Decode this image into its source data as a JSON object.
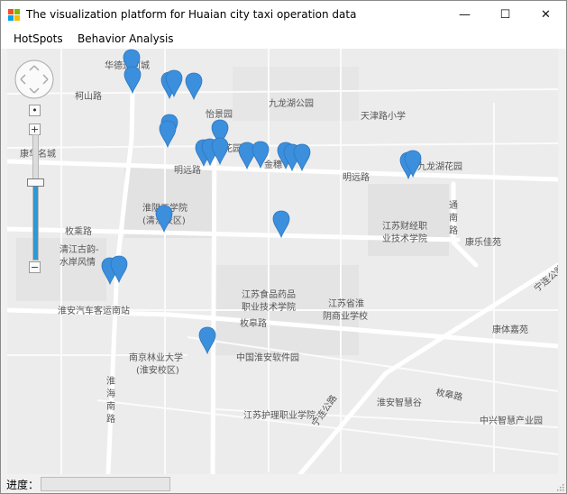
{
  "window": {
    "title": "The visualization platform for Huaian city taxi operation data",
    "minimize_label": "—",
    "maximize_label": "☐",
    "close_label": "✕"
  },
  "menu": {
    "items": [
      {
        "label": "HotSpots"
      },
      {
        "label": "Behavior Analysis"
      }
    ]
  },
  "map": {
    "zoom_in_label": "+",
    "zoom_out_label": "−",
    "zoom_out_min_label": "−",
    "center_label": "•",
    "zoom_level": 0.62,
    "marker_color": "#3b8fdd",
    "place_labels": [
      {
        "text": "华德运河城"
      },
      {
        "text": "柯山路"
      },
      {
        "text": "九龙湖公园"
      },
      {
        "text": "天津路小学"
      },
      {
        "text": "怡景园"
      },
      {
        "text": "康华名城"
      },
      {
        "text": "花园"
      },
      {
        "text": "明远路"
      },
      {
        "text": "金穗"
      },
      {
        "text": "明远路"
      },
      {
        "text": "九龙湖花园"
      },
      {
        "text": "淮阴工学院"
      },
      {
        "text": "(清江校区)"
      },
      {
        "text": "通"
      },
      {
        "text": "南"
      },
      {
        "text": "路"
      },
      {
        "text": "江苏财经职"
      },
      {
        "text": "业技术学院"
      },
      {
        "text": "康乐佳苑"
      },
      {
        "text": "枚乘路"
      },
      {
        "text": "清江古韵-"
      },
      {
        "text": "水岸风情"
      },
      {
        "text": "宁连公路"
      },
      {
        "text": "江苏食品药品"
      },
      {
        "text": "职业技术学院"
      },
      {
        "text": "江苏省淮"
      },
      {
        "text": "阴商业学校"
      },
      {
        "text": "淮安汽车客运南站"
      },
      {
        "text": "枚皋路"
      },
      {
        "text": "康体嘉苑"
      },
      {
        "text": "南京林业大学"
      },
      {
        "text": "(淮安校区)"
      },
      {
        "text": "中国淮安软件园"
      },
      {
        "text": "淮"
      },
      {
        "text": "海"
      },
      {
        "text": "南"
      },
      {
        "text": "路"
      },
      {
        "text": "枚皋路"
      },
      {
        "text": "宁连公路"
      },
      {
        "text": "淮安智慧谷"
      },
      {
        "text": "江苏护理职业学院"
      },
      {
        "text": "中兴智慧产业园"
      }
    ]
  },
  "status": {
    "label": "进度：",
    "progress": 0
  }
}
